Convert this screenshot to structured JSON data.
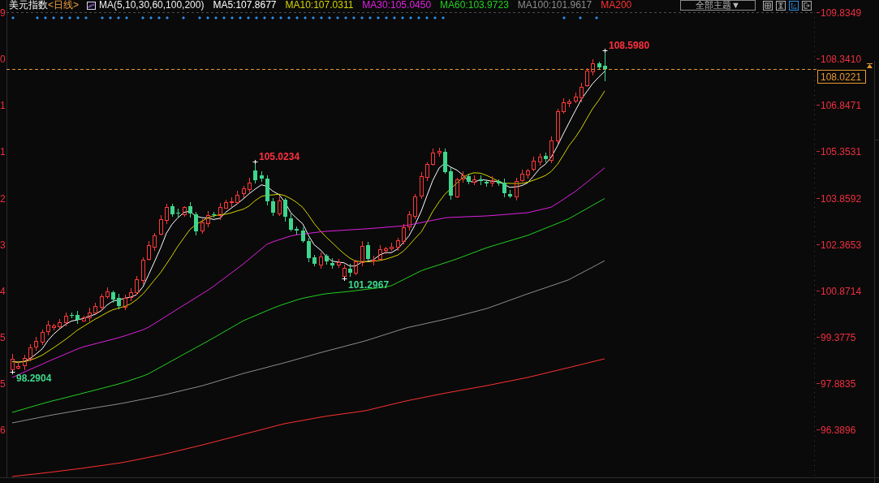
{
  "header": {
    "title": "美元指数",
    "period": "<日线>",
    "indicator": "MA(5,10,30,60,100,200)",
    "moving_averages": [
      {
        "label": "MA5:107.8677",
        "color": "#ffffff"
      },
      {
        "label": "MA10:107.0311",
        "color": "#d4d400"
      },
      {
        "label": "MA30:105.0450",
        "color": "#e020e0"
      },
      {
        "label": "MA60:103.9723",
        "color": "#20d020"
      },
      {
        "label": "MA100:101.9617",
        "color": "#8c8c8c"
      },
      {
        "label": "MA200",
        "color": "#ff3030"
      }
    ]
  },
  "toolbar": {
    "theme_dropdown": "全部主题▼",
    "buttons": [
      {
        "kind": "grid",
        "selected": false
      },
      {
        "kind": "range",
        "selected": false
      },
      {
        "kind": "axis",
        "selected": true
      },
      {
        "kind": "export",
        "selected": false
      }
    ]
  },
  "left_axis": {
    "labels": [
      "9",
      "0",
      "1",
      "1",
      "2",
      "3",
      "4",
      "5",
      "5",
      "6"
    ]
  },
  "price_axis": {
    "labels": [
      "109.8349",
      "108.3410",
      "106.8471",
      "105.3531",
      "103.8592",
      "102.3653",
      "100.8714",
      "99.3775",
      "97.8835",
      "96.3896"
    ],
    "current_price": "108.0221"
  },
  "annotations": [
    {
      "kind": "high",
      "text": "108.5980"
    },
    {
      "kind": "high",
      "text": "105.0234"
    },
    {
      "kind": "low",
      "text": "101.2967"
    },
    {
      "kind": "low",
      "text": "98.2904"
    }
  ]
}
